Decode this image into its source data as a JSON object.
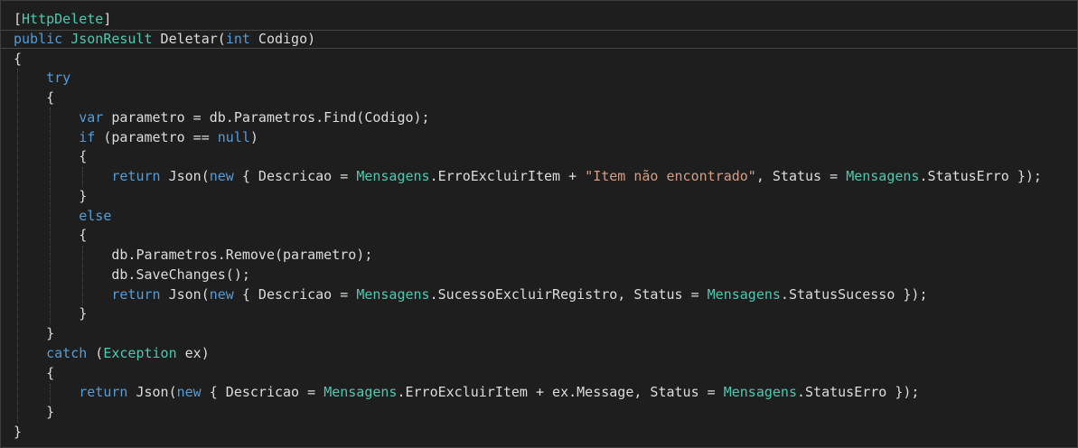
{
  "lines": [
    [
      {
        "t": "[",
        "c": "pl"
      },
      {
        "t": "HttpDelete",
        "c": "at"
      },
      {
        "t": "]",
        "c": "pl"
      }
    ],
    [
      {
        "t": "public",
        "c": "kw"
      },
      {
        "t": " ",
        "c": "pl"
      },
      {
        "t": "JsonResult",
        "c": "ty"
      },
      {
        "t": " Deletar(",
        "c": "pl"
      },
      {
        "t": "int",
        "c": "kw"
      },
      {
        "t": " Codigo)",
        "c": "pl"
      }
    ],
    [
      {
        "t": "{",
        "c": "pl"
      }
    ],
    [
      {
        "t": "    ",
        "c": "pl"
      },
      {
        "t": "try",
        "c": "kw"
      }
    ],
    [
      {
        "t": "    {",
        "c": "pl"
      }
    ],
    [
      {
        "t": "        ",
        "c": "pl"
      },
      {
        "t": "var",
        "c": "kw"
      },
      {
        "t": " parametro = db.Parametros.Find(Codigo);",
        "c": "pl"
      }
    ],
    [
      {
        "t": "        ",
        "c": "pl"
      },
      {
        "t": "if",
        "c": "kw"
      },
      {
        "t": " (parametro == ",
        "c": "pl"
      },
      {
        "t": "null",
        "c": "kw"
      },
      {
        "t": ")",
        "c": "pl"
      }
    ],
    [
      {
        "t": "        {",
        "c": "pl"
      }
    ],
    [
      {
        "t": "            ",
        "c": "pl"
      },
      {
        "t": "return",
        "c": "kw"
      },
      {
        "t": " Json(",
        "c": "pl"
      },
      {
        "t": "new",
        "c": "kw"
      },
      {
        "t": " { Descricao = ",
        "c": "pl"
      },
      {
        "t": "Mensagens",
        "c": "ty"
      },
      {
        "t": ".ErroExcluirItem + ",
        "c": "pl"
      },
      {
        "t": "\"Item não encontrado\"",
        "c": "st"
      },
      {
        "t": ", Status = ",
        "c": "pl"
      },
      {
        "t": "Mensagens",
        "c": "ty"
      },
      {
        "t": ".StatusErro });",
        "c": "pl"
      }
    ],
    [
      {
        "t": "        }",
        "c": "pl"
      }
    ],
    [
      {
        "t": "        ",
        "c": "pl"
      },
      {
        "t": "else",
        "c": "kw"
      }
    ],
    [
      {
        "t": "        {",
        "c": "pl"
      }
    ],
    [
      {
        "t": "            db.Parametros.Remove(parametro);",
        "c": "pl"
      }
    ],
    [
      {
        "t": "            db.SaveChanges();",
        "c": "pl"
      }
    ],
    [
      {
        "t": "            ",
        "c": "pl"
      },
      {
        "t": "return",
        "c": "kw"
      },
      {
        "t": " Json(",
        "c": "pl"
      },
      {
        "t": "new",
        "c": "kw"
      },
      {
        "t": " { Descricao = ",
        "c": "pl"
      },
      {
        "t": "Mensagens",
        "c": "ty"
      },
      {
        "t": ".SucessoExcluirRegistro, Status = ",
        "c": "pl"
      },
      {
        "t": "Mensagens",
        "c": "ty"
      },
      {
        "t": ".StatusSucesso });",
        "c": "pl"
      }
    ],
    [
      {
        "t": "        }",
        "c": "pl"
      }
    ],
    [
      {
        "t": "    }",
        "c": "pl"
      }
    ],
    [
      {
        "t": "    ",
        "c": "pl"
      },
      {
        "t": "catch",
        "c": "kw"
      },
      {
        "t": " (",
        "c": "pl"
      },
      {
        "t": "Exception",
        "c": "ty"
      },
      {
        "t": " ex)",
        "c": "pl"
      }
    ],
    [
      {
        "t": "    {",
        "c": "pl"
      }
    ],
    [
      {
        "t": "        ",
        "c": "pl"
      },
      {
        "t": "return",
        "c": "kw"
      },
      {
        "t": " Json(",
        "c": "pl"
      },
      {
        "t": "new",
        "c": "kw"
      },
      {
        "t": " { Descricao = ",
        "c": "pl"
      },
      {
        "t": "Mensagens",
        "c": "ty"
      },
      {
        "t": ".ErroExcluirItem + ex.Message, Status = ",
        "c": "pl"
      },
      {
        "t": "Mensagens",
        "c": "ty"
      },
      {
        "t": ".StatusErro });",
        "c": "pl"
      }
    ],
    [
      {
        "t": "    }",
        "c": "pl"
      }
    ],
    [
      {
        "t": "}",
        "c": "pl"
      }
    ]
  ],
  "colors": {
    "background": "#1e1e1e",
    "keyword": "#569cd6",
    "type": "#4ec9b0",
    "string": "#d69d85",
    "plain": "#dcdcdc"
  }
}
